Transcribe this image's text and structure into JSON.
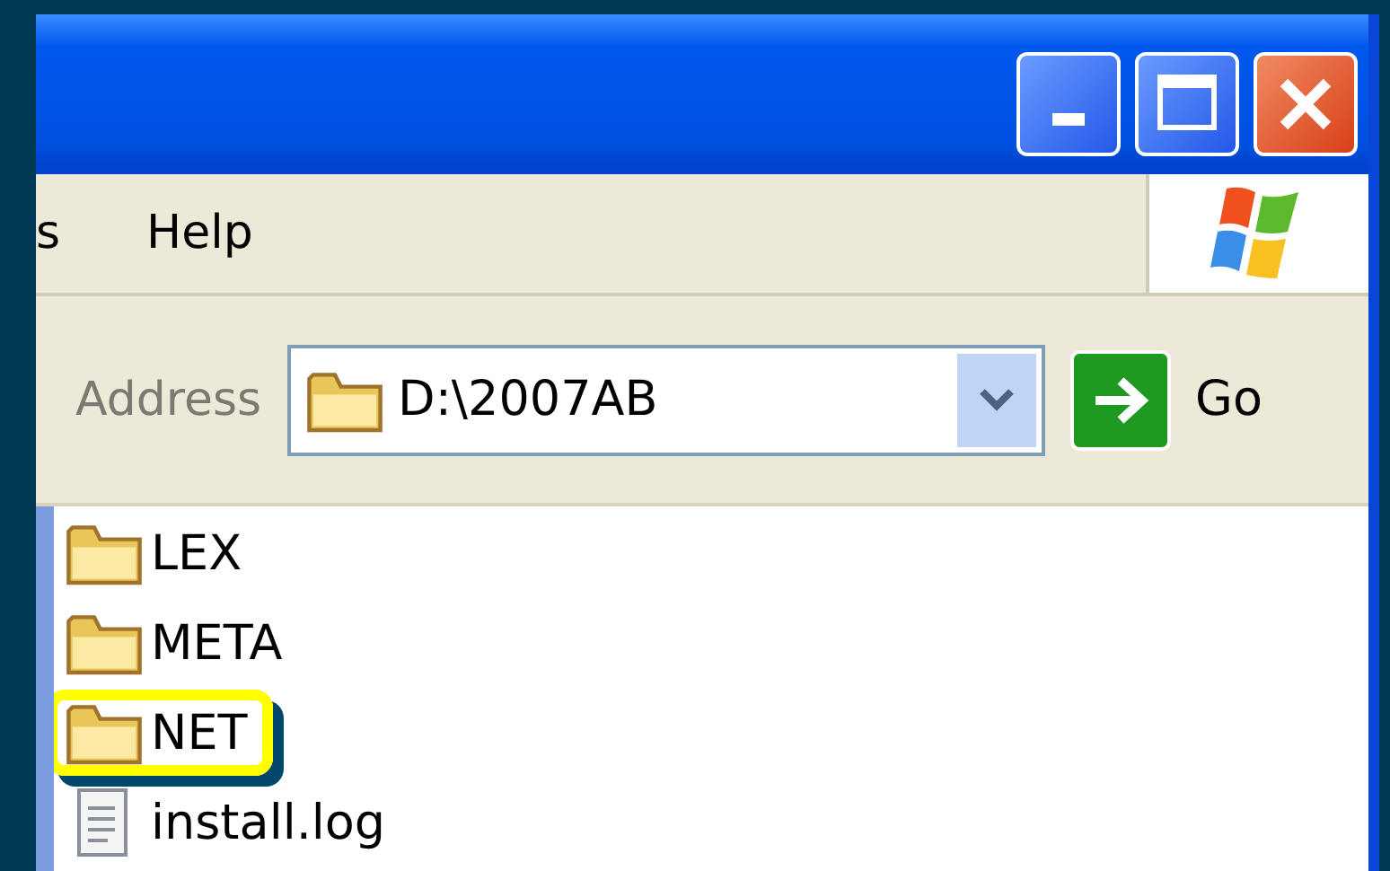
{
  "window": {
    "title_buttons": [
      {
        "kind": "minimize"
      },
      {
        "kind": "maximize"
      },
      {
        "kind": "close"
      }
    ]
  },
  "menu": [
    "s",
    "Help"
  ],
  "address_bar": {
    "label": "Address",
    "value": "D:\\2007AB",
    "go": "Go"
  },
  "files": [
    {
      "name": "LEX",
      "kind": "folder",
      "highlighted": false
    },
    {
      "name": "META",
      "kind": "folder",
      "highlighted": false
    },
    {
      "name": "NET",
      "kind": "folder",
      "highlighted": true
    },
    {
      "name": "install.log",
      "kind": "document",
      "highlighted": false
    }
  ]
}
